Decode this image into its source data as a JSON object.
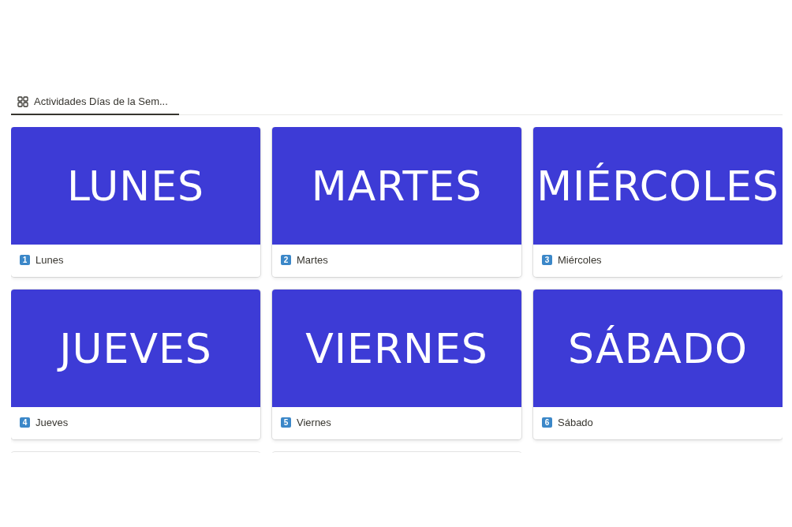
{
  "tab": {
    "label": "Actividades Días de la Sem...",
    "selected": true
  },
  "cards": [
    {
      "kind": "card",
      "cover": "LUNES",
      "badge": "1",
      "title": "Lunes"
    },
    {
      "kind": "card",
      "cover": "MARTES",
      "badge": "2",
      "title": "Martes"
    },
    {
      "kind": "card",
      "cover": "MIÉRCOLES",
      "badge": "3",
      "title": "Miércoles"
    },
    {
      "kind": "card",
      "cover": "JUEVES",
      "badge": "4",
      "title": "Jueves"
    },
    {
      "kind": "card",
      "cover": "VIERNES",
      "badge": "5",
      "title": "Viernes"
    },
    {
      "kind": "card",
      "cover": "SÁBADO",
      "badge": "6",
      "title": "Sábado"
    },
    {
      "kind": "cut"
    },
    {
      "kind": "cut"
    }
  ]
}
